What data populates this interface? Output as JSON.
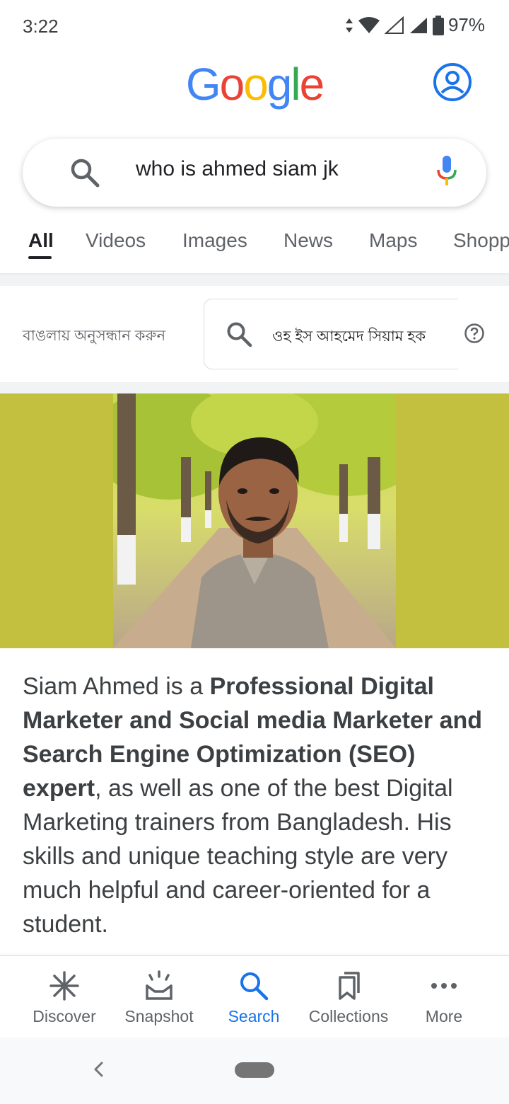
{
  "status_bar": {
    "time": "3:22",
    "battery": "97%",
    "icons": [
      "data-arrows-icon",
      "wifi-icon",
      "signal-icon",
      "battery-icon"
    ]
  },
  "header": {
    "logo_letters": [
      {
        "char": "G",
        "color": "#4285F4"
      },
      {
        "char": "o",
        "color": "#EA4335"
      },
      {
        "char": "o",
        "color": "#FBBC05"
      },
      {
        "char": "g",
        "color": "#4285F4"
      },
      {
        "char": "l",
        "color": "#34A853"
      },
      {
        "char": "e",
        "color": "#EA4335"
      }
    ],
    "account_icon": "account-circle-icon"
  },
  "search": {
    "query": "who is ahmed siam jk"
  },
  "tabs": [
    {
      "label": "All",
      "active": true
    },
    {
      "label": "Videos"
    },
    {
      "label": "Images"
    },
    {
      "label": "News"
    },
    {
      "label": "Maps"
    },
    {
      "label": "Shopp"
    }
  ],
  "translate": {
    "label": "বাঙলায় অনুসন্ধান করুন",
    "query": "ওহ ইস আহমেদ সিয়াম হক"
  },
  "description": {
    "plain_start": "Siam Ahmed is a ",
    "bold": "Professional Digital Marketer and Social media Marketer and Search Engine Optimization (SEO) expert",
    "plain_end": ", as well as one of the best Digital Marketing trainers from Bangladesh. His skills and unique teaching style are very much helpful and career-oriented for a student."
  },
  "bottom_nav": [
    {
      "label": "Discover",
      "icon": "asterisk-icon"
    },
    {
      "label": "Snapshot",
      "icon": "snapshot-icon"
    },
    {
      "label": "Search",
      "icon": "search-icon",
      "active": true
    },
    {
      "label": "Collections",
      "icon": "collections-icon"
    },
    {
      "label": "More",
      "icon": "more-dots-icon"
    }
  ],
  "colors": {
    "accent": "#1a73e8",
    "image_background": "#c2c03e"
  }
}
